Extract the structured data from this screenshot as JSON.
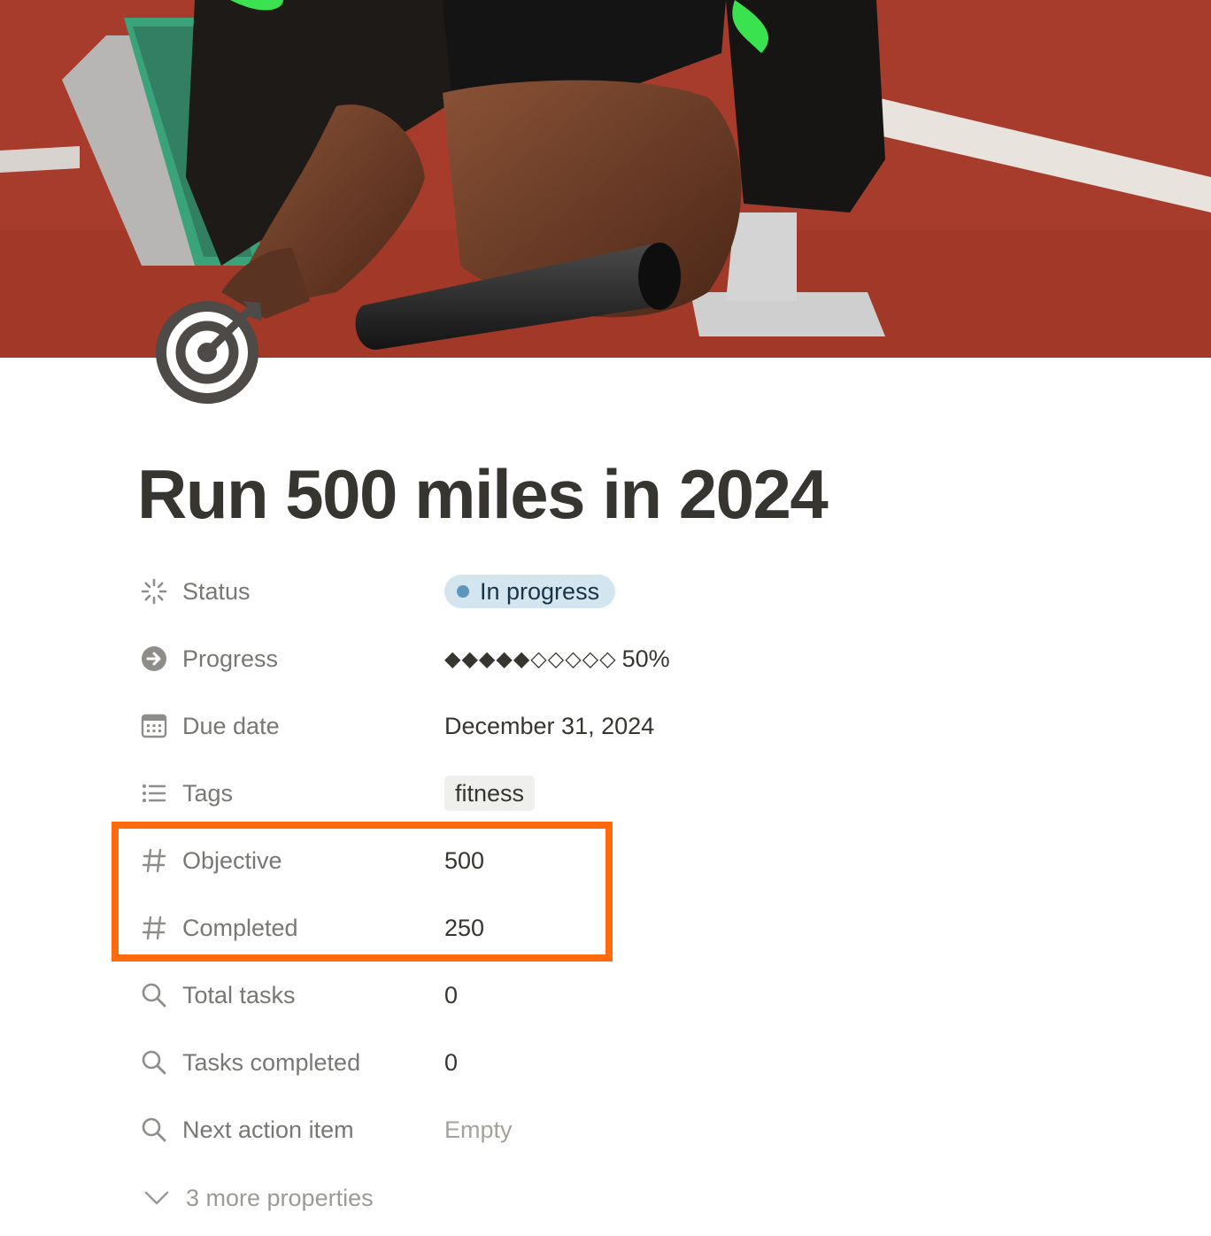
{
  "page": {
    "title": "Run 500 miles in 2024",
    "cover_image": "track-start-blocks-runner-cover",
    "page_icon": "target-icon"
  },
  "properties": [
    {
      "icon": "status-icon",
      "label": "Status",
      "value": "In progress",
      "value_type": "status-pill",
      "status_color": "#5b97bd"
    },
    {
      "icon": "arrow-circle-icon",
      "label": "Progress",
      "value": "◆◆◆◆◆◇◇◇◇◇",
      "percent": "50%",
      "progress_fraction": 0.5,
      "value_type": "progress"
    },
    {
      "icon": "calendar-icon",
      "label": "Due date",
      "value": "December 31, 2024",
      "value_type": "text"
    },
    {
      "icon": "list-icon",
      "label": "Tags",
      "value": "fitness",
      "value_type": "tag"
    },
    {
      "icon": "hash-icon",
      "label": "Objective",
      "value": "500",
      "value_type": "number"
    },
    {
      "icon": "hash-icon",
      "label": "Completed",
      "value": "250",
      "value_type": "number"
    },
    {
      "icon": "search-icon",
      "label": "Total tasks",
      "value": "0",
      "value_type": "rollup"
    },
    {
      "icon": "search-icon",
      "label": "Tasks completed",
      "value": "0",
      "value_type": "rollup"
    },
    {
      "icon": "search-icon",
      "label": "Next action item",
      "value": "Empty",
      "value_type": "empty"
    }
  ],
  "more_properties_label": "3 more properties",
  "colors": {
    "highlight_border": "#ff6a0f",
    "status_pill_bg": "#d3e5ef",
    "tag_pill_bg": "#efefed"
  }
}
